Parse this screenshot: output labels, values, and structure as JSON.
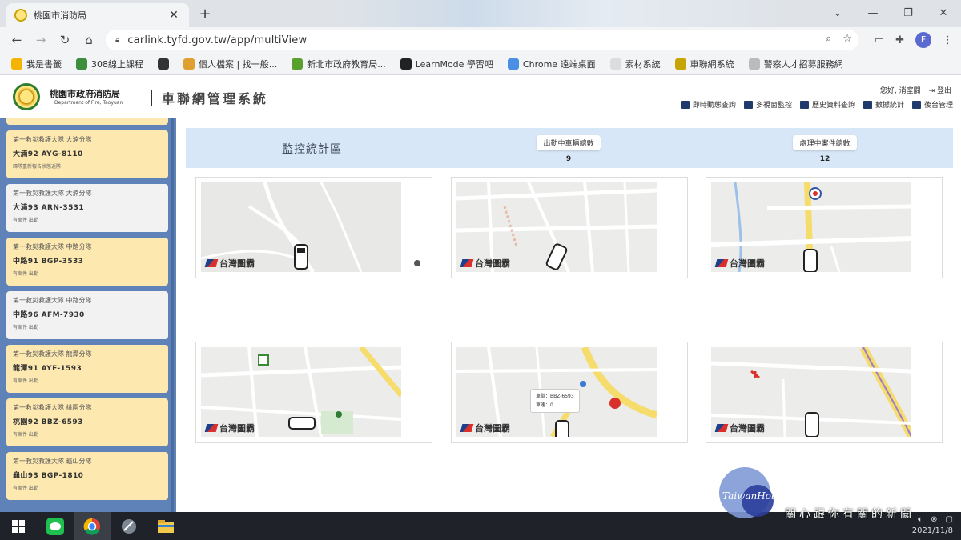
{
  "browser": {
    "tab_title": "桃園市消防局",
    "url": "carlink.tyfd.gov.tw/app/multiView",
    "profile_initial": "F",
    "bookmarks": [
      {
        "label": "我是書籤",
        "color": "#f5b400"
      },
      {
        "label": "308線上課程",
        "color": "#3c8d3c"
      },
      {
        "label": "",
        "color": "#333333"
      },
      {
        "label": "個人檔案 | 找一般...",
        "color": "#e0a030"
      },
      {
        "label": "新北市政府教育局...",
        "color": "#5aa02c"
      },
      {
        "label": "LearnMode 學習吧",
        "color": "#222222"
      },
      {
        "label": "Chrome 遠端桌面",
        "color": "#4a90e2"
      },
      {
        "label": "素材系統",
        "color": "#dddddd"
      },
      {
        "label": "車聯網系統",
        "color": "#c8a400"
      },
      {
        "label": "警察人才招募服務網",
        "color": "#bbbbbb"
      }
    ]
  },
  "header": {
    "org_name": "桃園市政府消防局",
    "org_en": "Department of Fire, Taoyuan",
    "system_title": "車聯網管理系統",
    "user_greeting": "您好, 消室闢",
    "logout": "登出",
    "menu": [
      {
        "label": "即時動態查詢",
        "icon": "home-icon"
      },
      {
        "label": "多視窗監控",
        "icon": "monitor-icon"
      },
      {
        "label": "歷史資料查詢",
        "icon": "folder-icon"
      },
      {
        "label": "數據統計",
        "icon": "chart-icon"
      },
      {
        "label": "後台管理",
        "icon": "gear-icon"
      }
    ]
  },
  "sidebar": {
    "vehicles": [
      {
        "unit": "第一救災救護大隊 大湳分隊",
        "plate": "大湳92 AYG-8110",
        "status": "歸隊重新報告狀態返隊",
        "color": "yellow"
      },
      {
        "unit": "第一救災救護大隊 大湳分隊",
        "plate": "大湳93 ARN-3531",
        "status": "有案件 出勤",
        "color": "white"
      },
      {
        "unit": "第一救災救護大隊 中路分隊",
        "plate": "中路91 BGP-3533",
        "status": "有案件 出勤",
        "color": "yellow"
      },
      {
        "unit": "第一救災救護大隊 中路分隊",
        "plate": "中路96 AFM-7930",
        "status": "有案件 出勤",
        "color": "white"
      },
      {
        "unit": "第一救災救護大隊 龍潭分隊",
        "plate": "龍潭91 AYF-1593",
        "status": "有案件 出勤",
        "color": "yellow"
      },
      {
        "unit": "第一救災救護大隊 桃園分隊",
        "plate": "桃園92 BBZ-6593",
        "status": "有案件 出勤",
        "color": "yellow"
      },
      {
        "unit": "第一救災救護大隊 龜山分隊",
        "plate": "龜山93 BGP-1810",
        "status": "有案件 出勤",
        "color": "yellow"
      }
    ]
  },
  "stats": {
    "title": "監控統計區",
    "dispatched_label": "出勤中車輛總數",
    "dispatched_value": "9",
    "events_label": "處理中案件總數",
    "events_value": "12"
  },
  "maps": {
    "brand": "台灣圖霸",
    "popup_lines": [
      "車號：BBZ-6593",
      "車速：0"
    ]
  },
  "taskbar": {
    "date": "2021/11/8"
  },
  "watermark": {
    "logo_text": "TaiwanHot",
    "slogan": "關心跟你有關的新聞"
  }
}
